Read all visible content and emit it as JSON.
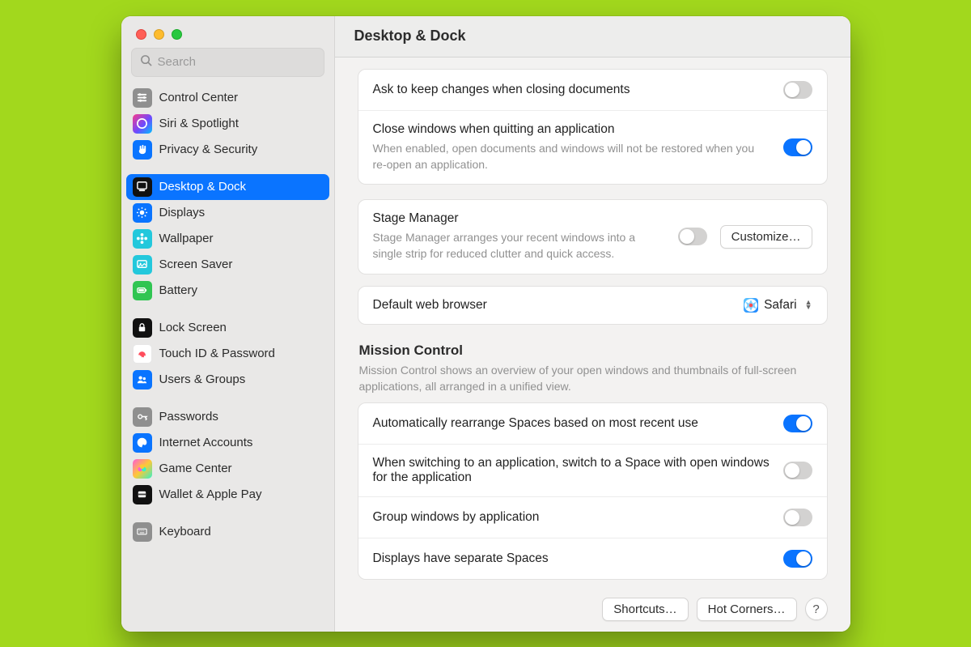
{
  "window": {
    "title": "Desktop & Dock"
  },
  "search": {
    "placeholder": "Search"
  },
  "sidebar": {
    "groups": [
      {
        "items": [
          {
            "label": "Control Center",
            "icon": "sliders-icon",
            "bg": "#8f8f8f"
          },
          {
            "label": "Siri & Spotlight",
            "icon": "siri-icon",
            "bg_css": "linear-gradient(135deg,#f93a8b,#6d4aff 55%,#00c2ff)"
          },
          {
            "label": "Privacy & Security",
            "icon": "hand-icon",
            "bg": "#0a74ff"
          }
        ]
      },
      {
        "items": [
          {
            "label": "Desktop & Dock",
            "icon": "dock-icon",
            "bg": "#111",
            "selected": true
          },
          {
            "label": "Displays",
            "icon": "sun-icon",
            "bg": "#0a74ff"
          },
          {
            "label": "Wallpaper",
            "icon": "flower-icon",
            "bg": "#23c8dc"
          },
          {
            "label": "Screen Saver",
            "icon": "screensaver-icon",
            "bg": "#23c8dc"
          },
          {
            "label": "Battery",
            "icon": "battery-icon",
            "bg": "#30c552"
          }
        ]
      },
      {
        "items": [
          {
            "label": "Lock Screen",
            "icon": "lock-icon",
            "bg": "#111"
          },
          {
            "label": "Touch ID & Password",
            "icon": "fingerprint-icon",
            "bg": "#fff",
            "fg": "#ff4c5c",
            "border": "#e7e7e7"
          },
          {
            "label": "Users & Groups",
            "icon": "users-icon",
            "bg": "#0a74ff"
          }
        ]
      },
      {
        "items": [
          {
            "label": "Passwords",
            "icon": "key-icon",
            "bg": "#8f8f8f"
          },
          {
            "label": "Internet Accounts",
            "icon": "at-icon",
            "bg": "#0a74ff"
          },
          {
            "label": "Game Center",
            "icon": "gamecenter-icon",
            "bg_css": "linear-gradient(135deg,#ff5bd7,#ffc837 50%,#37f0c3)"
          },
          {
            "label": "Wallet & Apple Pay",
            "icon": "wallet-icon",
            "bg": "#111"
          }
        ]
      },
      {
        "items": [
          {
            "label": "Keyboard",
            "icon": "keyboard-icon",
            "bg": "#8f8f8f"
          }
        ]
      }
    ]
  },
  "panel": {
    "ask_keep": {
      "title": "Ask to keep changes when closing documents",
      "on": false
    },
    "close_quit": {
      "title": "Close windows when quitting an application",
      "desc": "When enabled, open documents and windows will not be restored when you re-open an application.",
      "on": true
    },
    "stage": {
      "title": "Stage Manager",
      "desc": "Stage Manager arranges your recent windows into a single strip for reduced clutter and quick access.",
      "on": false,
      "customize_label": "Customize…"
    },
    "browser": {
      "label": "Default web browser",
      "value": "Safari"
    },
    "mission": {
      "title": "Mission Control",
      "desc": "Mission Control shows an overview of your open windows and thumbnails of full-screen applications, all arranged in a unified view.",
      "rows": [
        {
          "title": "Automatically rearrange Spaces based on most recent use",
          "on": true
        },
        {
          "title": "When switching to an application, switch to a Space with open windows for the application",
          "on": false
        },
        {
          "title": "Group windows by application",
          "on": false
        },
        {
          "title": "Displays have separate Spaces",
          "on": true
        }
      ]
    },
    "footer": {
      "shortcuts": "Shortcuts…",
      "hot_corners": "Hot Corners…",
      "help": "?"
    }
  }
}
